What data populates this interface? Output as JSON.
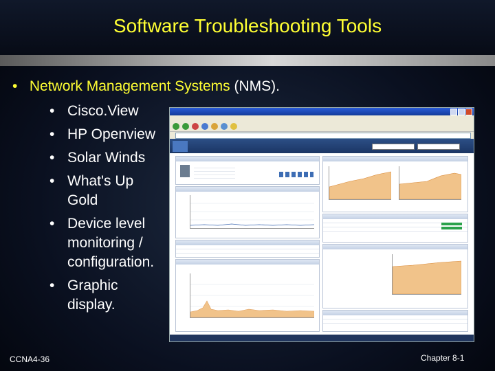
{
  "slide": {
    "title": "Software Troubleshooting Tools",
    "main_bullet_highlight": "Network Management Systems",
    "main_bullet_rest": "(NMS).",
    "sub_items": [
      "Cisco.View",
      "HP Openview",
      "Solar Winds",
      "What's Up Gold",
      "Device level monitoring / configuration.",
      "Graphic display."
    ],
    "footer_left": "CCNA4-36",
    "footer_right": "Chapter 8-1",
    "bullet_glyph": "•"
  },
  "screenshot": {
    "icon": "network-monitor-screenshot",
    "colors": {
      "title_text": "#ffff33",
      "accent_bar": "#2c4f86",
      "chart_fill": "#f1c38a"
    }
  }
}
